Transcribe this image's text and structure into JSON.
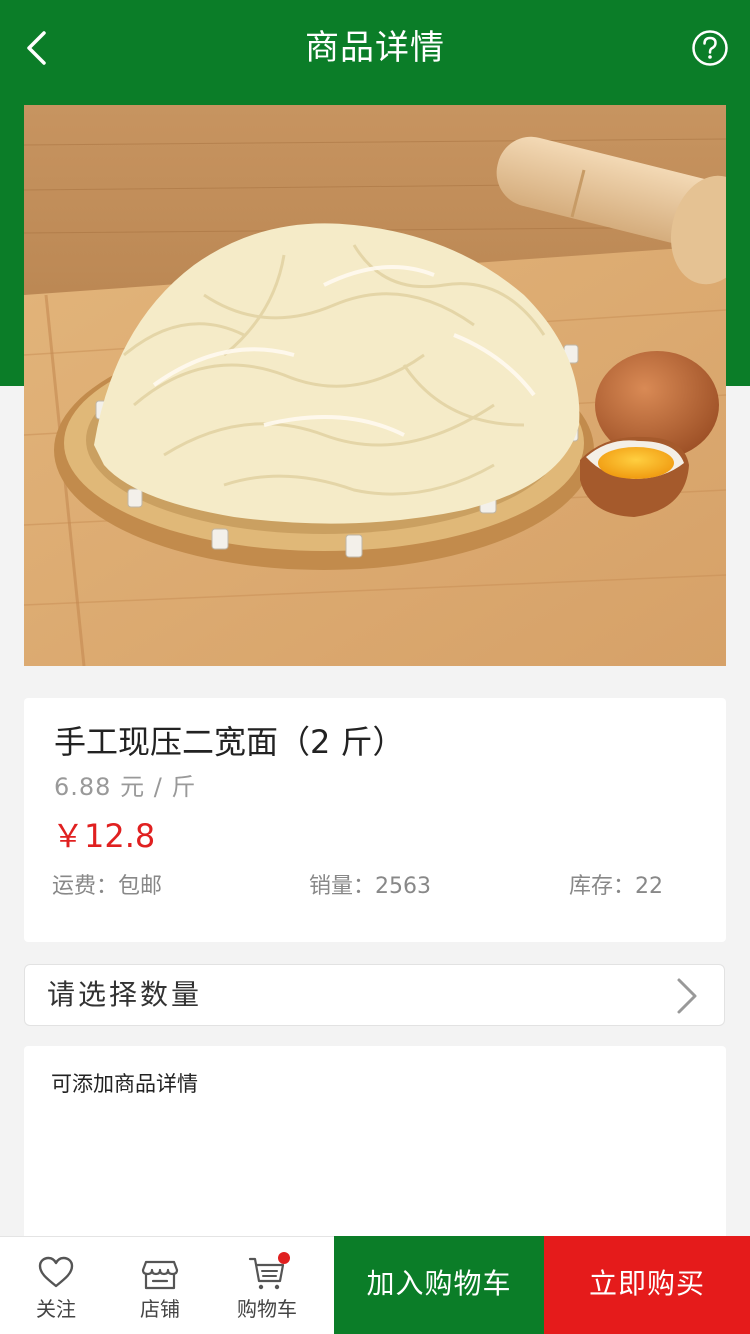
{
  "header": {
    "title": "商品详情",
    "back_icon": "chevron-left-icon",
    "help_icon": "question-circle-icon"
  },
  "product": {
    "image_alt": "noodles-on-bamboo-tray-image",
    "name": "手工现压二宽面（2 斤）",
    "unit_price": "6.88 元 / 斤",
    "price": "￥12.8",
    "shipping": "运费：包邮",
    "sales": "销量：2563",
    "stock": "库存：22"
  },
  "quantity": {
    "label": "请选择数量",
    "chevron_icon": "chevron-right-icon"
  },
  "details": {
    "placeholder": "可添加商品详情"
  },
  "bottom_nav": {
    "follow_label": "关注",
    "store_label": "店铺",
    "cart_label": "购物车",
    "add_to_cart_label": "加入购物车",
    "buy_now_label": "立即购买"
  },
  "colors": {
    "brand_green": "#0b7d28",
    "accent_red": "#e51b1b",
    "price_red": "#e02020"
  }
}
